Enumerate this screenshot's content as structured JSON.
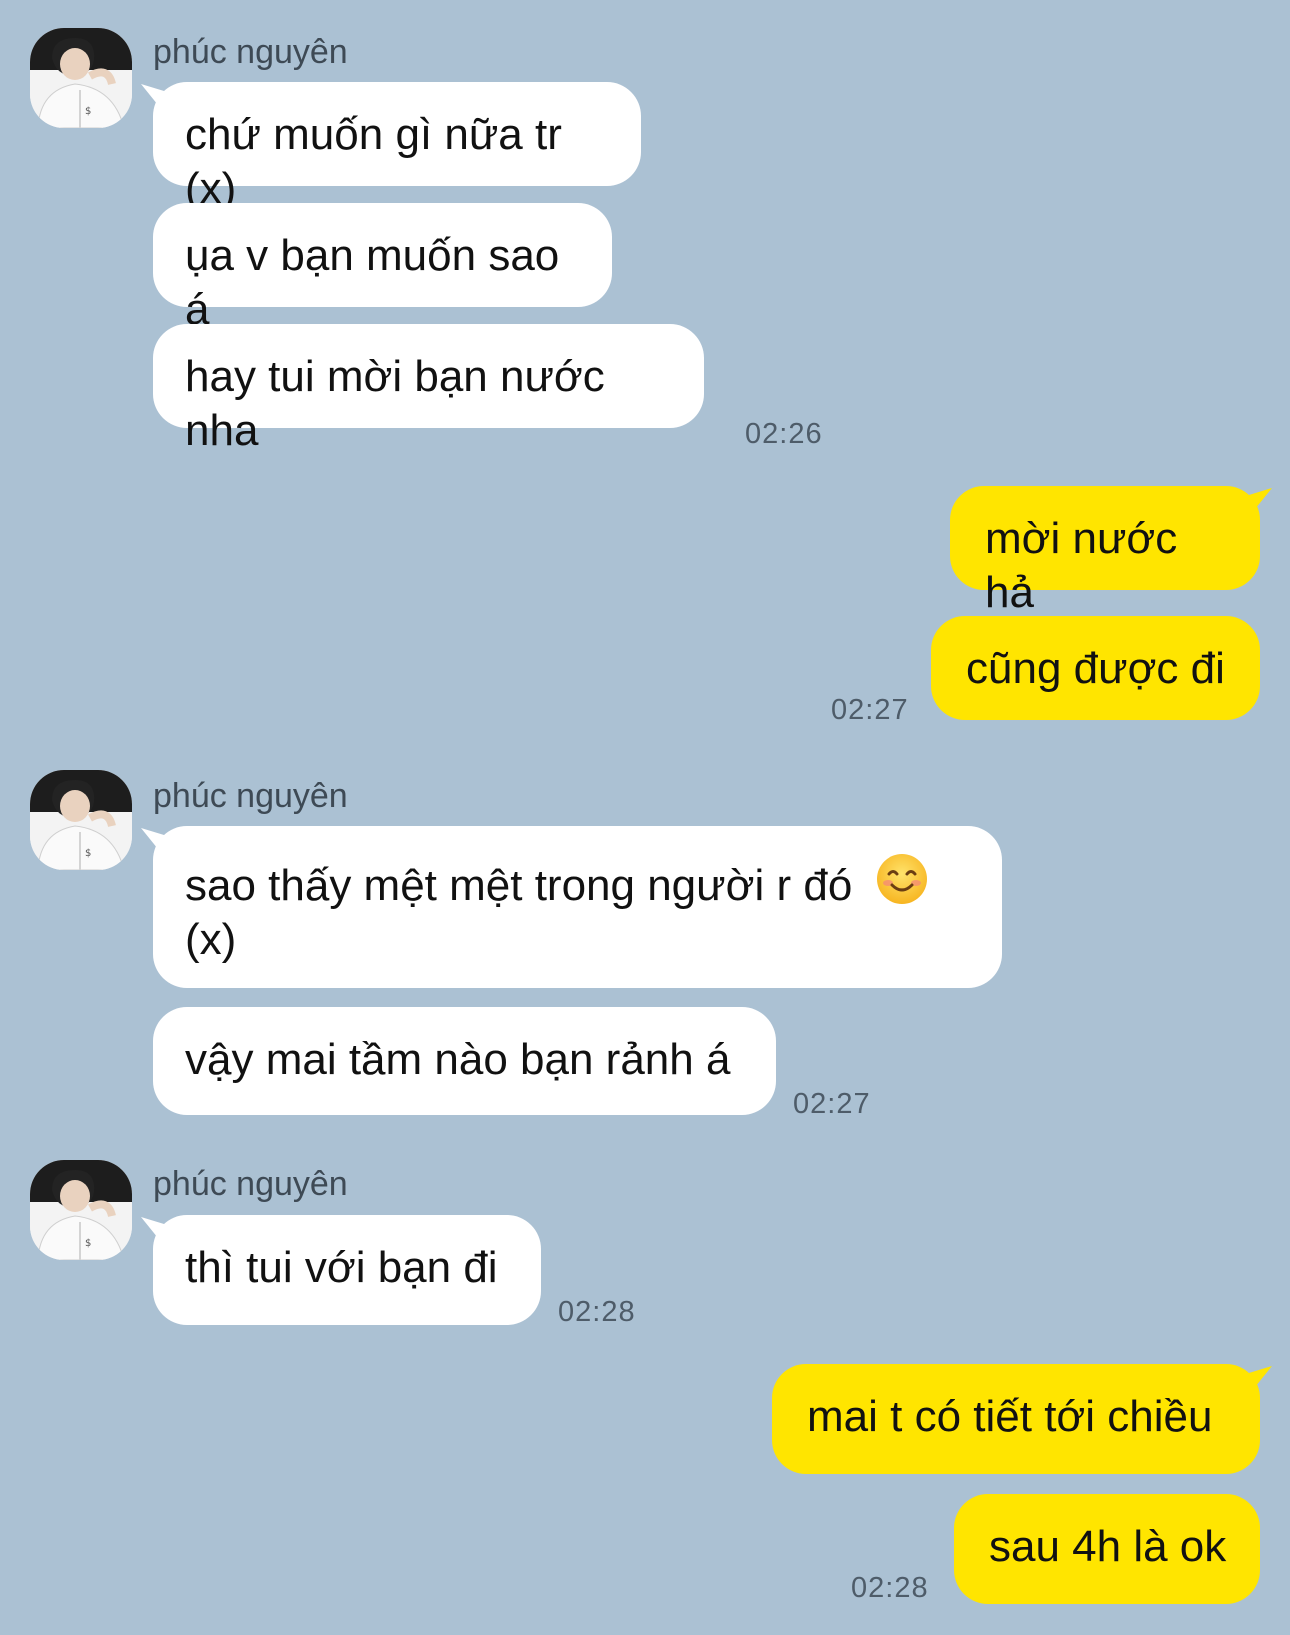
{
  "colors": {
    "background": "#abc1d3",
    "incoming_bubble": "#ffffff",
    "outgoing_bubble": "#ffe500"
  },
  "groups": [
    {
      "sender": "phúc nguyên",
      "avatar": "user-avatar-photo",
      "messages": [
        "chứ muốn gì nữa tr (x)",
        "ụa v bạn muốn sao á",
        "hay tui mời bạn nước nha"
      ],
      "time": "02:26"
    },
    {
      "sender": "",
      "messages": [
        "mời nước hả",
        "cũng được đi"
      ],
      "time": "02:27"
    },
    {
      "sender": "phúc nguyên",
      "avatar": "user-avatar-photo",
      "messages": [
        "sao thấy mệt mệt trong người r đó",
        "vậy mai tầm nào bạn rảnh á"
      ],
      "message_suffix": "(x)",
      "emoji": "smiling-face-emoji",
      "time": "02:27"
    },
    {
      "sender": "phúc nguyên",
      "avatar": "user-avatar-photo",
      "messages": [
        "thì tui với bạn đi"
      ],
      "time": "02:28"
    },
    {
      "sender": "",
      "messages": [
        "mai t có tiết tới chiều",
        "sau 4h là ok"
      ],
      "time": "02:28"
    }
  ]
}
